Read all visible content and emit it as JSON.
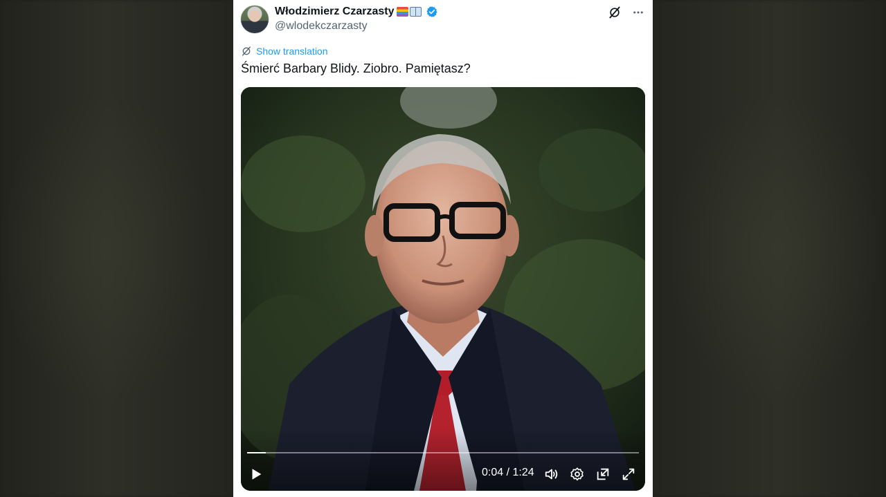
{
  "tweet": {
    "author_name": "Włodzimierz Czarzasty",
    "handle": "@wlodekczarzasty",
    "show_translation_label": "Show translation",
    "text": "Śmierć Barbary Blidy. Ziobro. Pamiętasz?"
  },
  "icons": {
    "grok": "grok-icon",
    "more": "more-icon",
    "verified": "verified-badge-icon",
    "translate": "translate-icon",
    "play": "play-icon",
    "volume": "volume-icon",
    "settings": "settings-icon",
    "minimize": "pip-icon",
    "fullscreen": "fullscreen-icon"
  },
  "video": {
    "current_time": "0:04",
    "duration": "1:24",
    "time_separator": "/",
    "progress_fraction": 0.048
  },
  "colors": {
    "accent": "#1d9bf0",
    "text": "#0f1419",
    "muted": "#536471"
  }
}
